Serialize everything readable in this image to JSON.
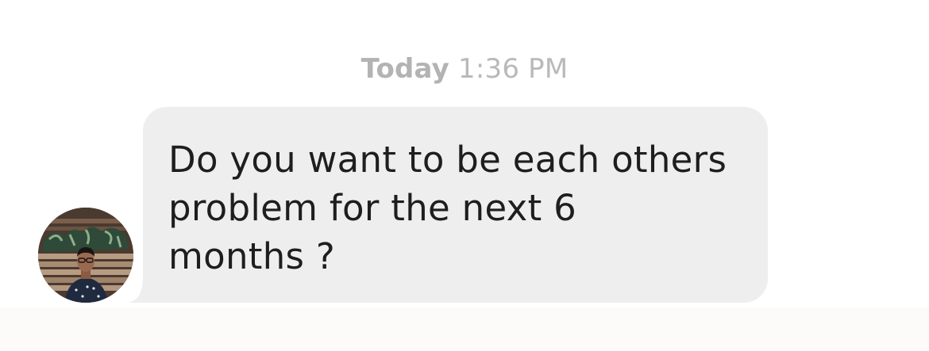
{
  "conversation": {
    "timestamp": {
      "day": "Today",
      "time": "1:36 PM"
    },
    "messages": [
      {
        "sender": "incoming",
        "text": "Do you want to be each others\nproblem for the next 6\nmonths ?",
        "avatar_icon": "user-avatar-photo"
      }
    ]
  },
  "colors": {
    "bubble_background": "#eeeeee",
    "bubble_text": "#1e1e1e",
    "timestamp_text": "#b6b6b6",
    "page_background": "#ffffff"
  }
}
